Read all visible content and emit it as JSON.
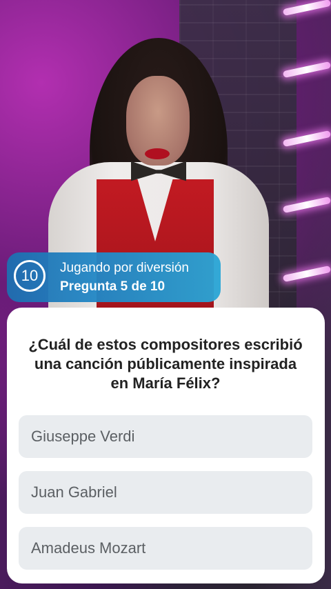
{
  "banner": {
    "timer": "10",
    "mode": "Jugando por diversión",
    "progress": "Pregunta 5 de 10"
  },
  "question": "¿Cuál de estos compositores escribió una canción públicamente inspirada en María Félix?",
  "options": [
    {
      "label": "Giuseppe Verdi"
    },
    {
      "label": "Juan Gabriel"
    },
    {
      "label": "Amadeus Mozart"
    }
  ],
  "colors": {
    "banner_start": "#1e6fb0",
    "banner_end": "#2aa6d6",
    "option_bg": "#e9ecef",
    "card_bg": "#ffffff"
  }
}
